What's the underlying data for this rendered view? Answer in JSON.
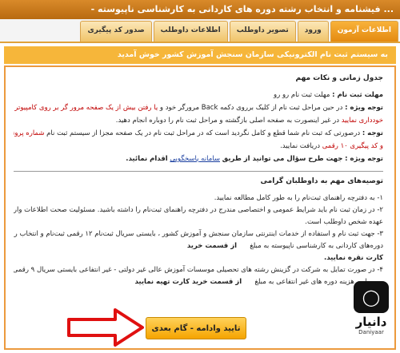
{
  "window": {
    "title": "... فیشنامه و انتخاب رشته دوره های کاردانی به کارشناسی ناپیوسته -"
  },
  "tabs": [
    {
      "label": "اطلاعات آزمون",
      "active": true
    },
    {
      "label": "ورود",
      "active": false
    },
    {
      "label": "تصویر داوطلب",
      "active": false
    },
    {
      "label": "اطلاعات داوطلب",
      "active": false
    },
    {
      "label": "صدور کد پیگیری",
      "active": false
    }
  ],
  "banner": "به سیستم ثبت نام الکترونیکی سازمان سنجش آموزش کشور خوش آمدید",
  "schedule": {
    "title": "جدول زمانی و نکات مهم",
    "deadline_label": "مهلت ثبت نام :",
    "deadline_value": "مهلت ثبت نام رو رو",
    "note1_label": "توجه ویژه :",
    "note1_text": "در حین مراحل ثبت نام از کلیک برروی دکمه Back مرورگر خود و",
    "note1_red": "یا رفتن بیش از یک صفحه مرور گر بر روی کامپیوتر خود جدا",
    "note1_cont": "خودداری نمایید",
    "note1_rest": "در غیر اینصورت به صفحه اصلی بازگشته و مراحل ثبت نام را دوباره انجام دهید.",
    "note2_label": "توجه :",
    "note2_text": "درصورتی که ثبت نام شما قطع و کامل نگردید است که در مراحل ثبت نام در یک صفحه مجزا از سیستم ثبت نام",
    "note2_red": "شماره پرونده ۶ رقمی",
    "note2_line2": "و کد پیگیری ۱۰ رقمی",
    "note2_rest": "دریافت نمایید.",
    "note3_label": "توجه ویژه :",
    "note3_text": "جهت طرح سؤال می توانید از طریق",
    "note3_link": "سامانه پاسخگویی",
    "note3_rest": "اقدام نمائید."
  },
  "advice": {
    "title": "توصیه‌های مهم به داوطلبان گرامی",
    "lines": [
      "۱- به دفترچه راهنمای ثبت‌نام را به طور کامل مطالعه نمایید.",
      "۲- در زمان ثبت نام باید شرایط عمومی و اختصاصی مندرج در دفترچه راهنمای ثبت‌نام را داشته باشید. مسئولیت صحت اطلاعات وارد شده بر",
      "عهده شخص داوطلب است.",
      "۳- جهت ثبت نام و استفاده از خدمات اینترنتی سازمان سنجش و آموزش کشور ، بایستی سریال ثبت‌نام ۱۲ رقمی ثبت‌نام و انتخاب رشته",
      "دوره‌های کاردانی به کارشناسی ناپیوسته به مبلغ",
      "کارت نقره نمایید.",
      "۴- در صورت تمایل به شرکت در گزینش رشته های تحصیلی موسسات آموزش عالی غیر دولتی - غیر انتفاعی بایستی سریال ۹ رقمی مقاله",
      "مربوط به هزینه دوره های غیر انتفاعی به مبلغ"
    ],
    "buy_card_label": "از قسمت خرید",
    "buy_card_label_2": "از قسمت خرید کارت تهیه نمایید"
  },
  "submit_button": {
    "label": "تایید وادامه - گام بعدی"
  },
  "logo": {
    "name": "دانیار",
    "latin": "Daniyaar"
  },
  "colors": {
    "accent": "#f6b63a",
    "border": "#ec9a3e",
    "red": "#c00000",
    "link": "#1a3fa0"
  }
}
